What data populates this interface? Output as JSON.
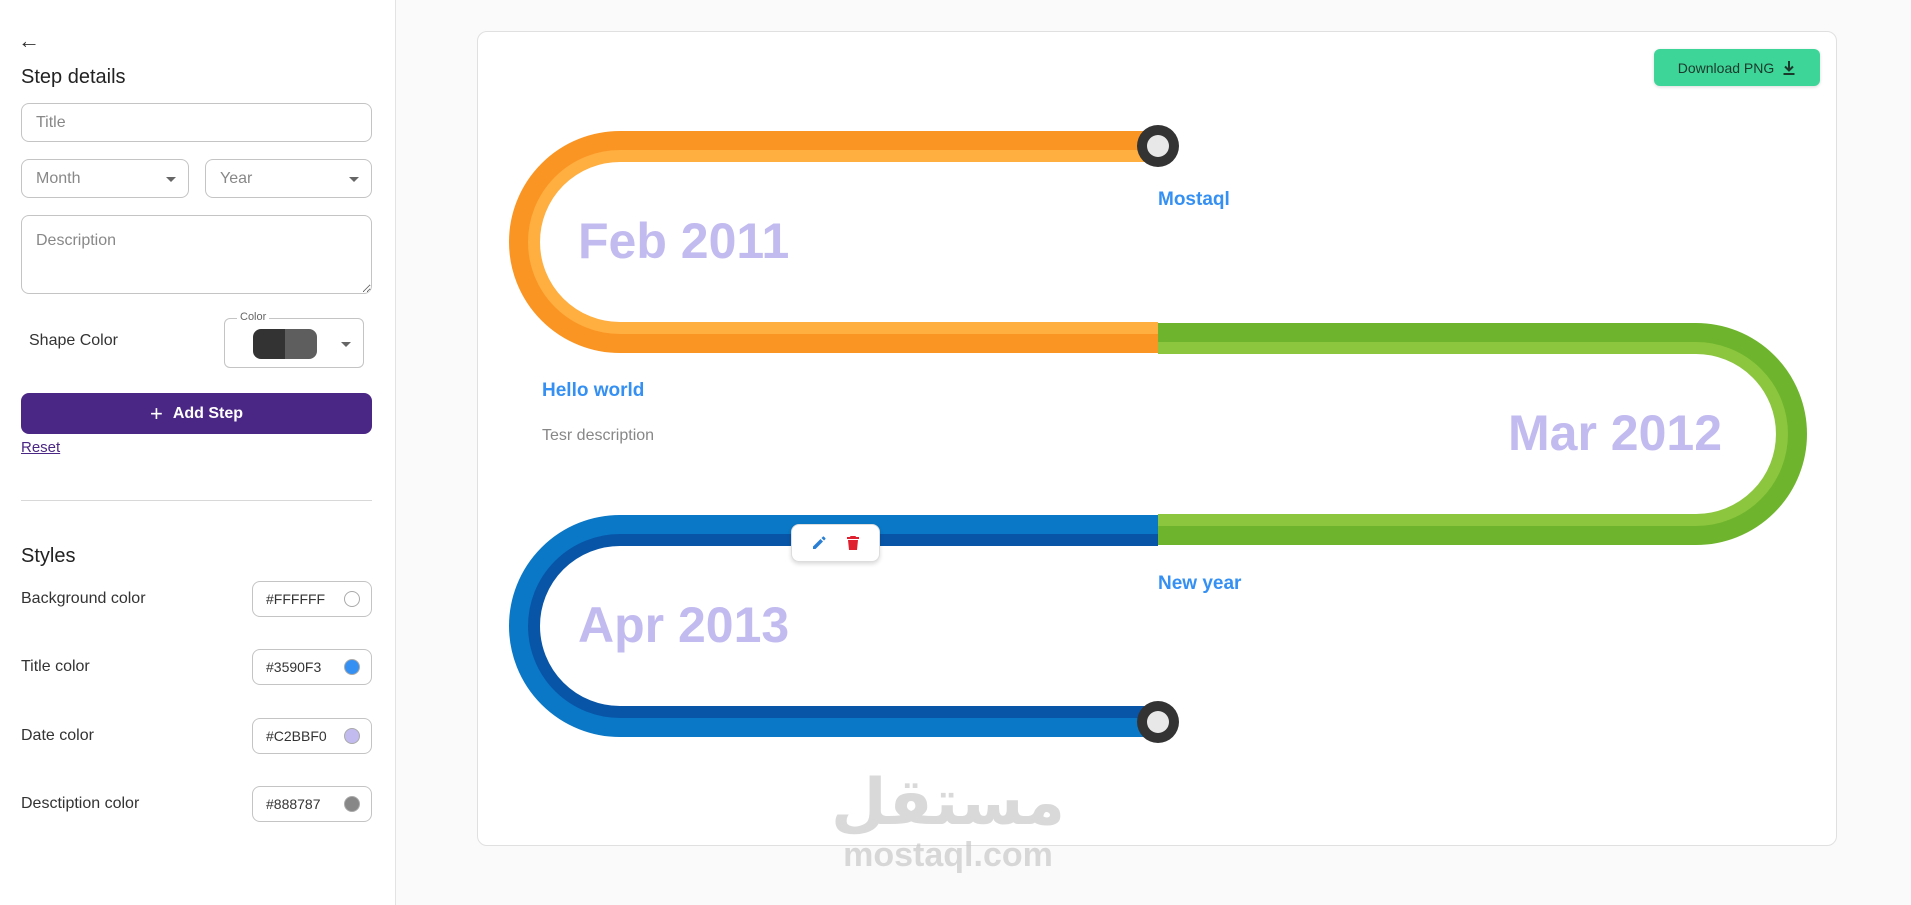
{
  "sidebar": {
    "heading": "Step details",
    "title_placeholder": "Title",
    "month_placeholder": "Month",
    "year_placeholder": "Year",
    "description_placeholder": "Description",
    "shape_color_label": "Shape Color",
    "color_legend": "Color",
    "shape_color_swatch": [
      "#333333",
      "#5e5e5e"
    ],
    "add_step_label": "Add Step",
    "reset_label": "Reset",
    "styles_heading": "Styles",
    "styles": [
      {
        "label": "Background color",
        "value": "#FFFFFF"
      },
      {
        "label": "Title color",
        "value": "#3590F3"
      },
      {
        "label": "Date color",
        "value": "#C2BBF0"
      },
      {
        "label": "Desctiption color",
        "value": "#888787"
      }
    ]
  },
  "main": {
    "download_label": "Download PNG",
    "steps": [
      {
        "date": "Feb 2011",
        "title": "Mostaql",
        "description": ""
      },
      {
        "date": "Mar 2012",
        "title": "Hello world",
        "description": "Tesr description"
      },
      {
        "date": "Apr 2013",
        "title": "New year",
        "description": ""
      }
    ],
    "colors": {
      "orange": [
        "#fa9524",
        "#ffae40"
      ],
      "green": [
        "#6eb52d",
        "#8cc63e"
      ],
      "blue": [
        "#0a78c7",
        "#0855a8"
      ],
      "node": "#333333",
      "node_center": "#e8e8e8",
      "title": "#3590F3",
      "date": "#C2BBF0",
      "description": "#888787",
      "edit_icon": "#2a7fd4",
      "delete_icon": "#e0202f",
      "download_bg": "#3dd598",
      "add_step_bg": "#4b2785"
    }
  },
  "watermark": {
    "arabic": "مستقل",
    "latin": "mostaql.com"
  }
}
